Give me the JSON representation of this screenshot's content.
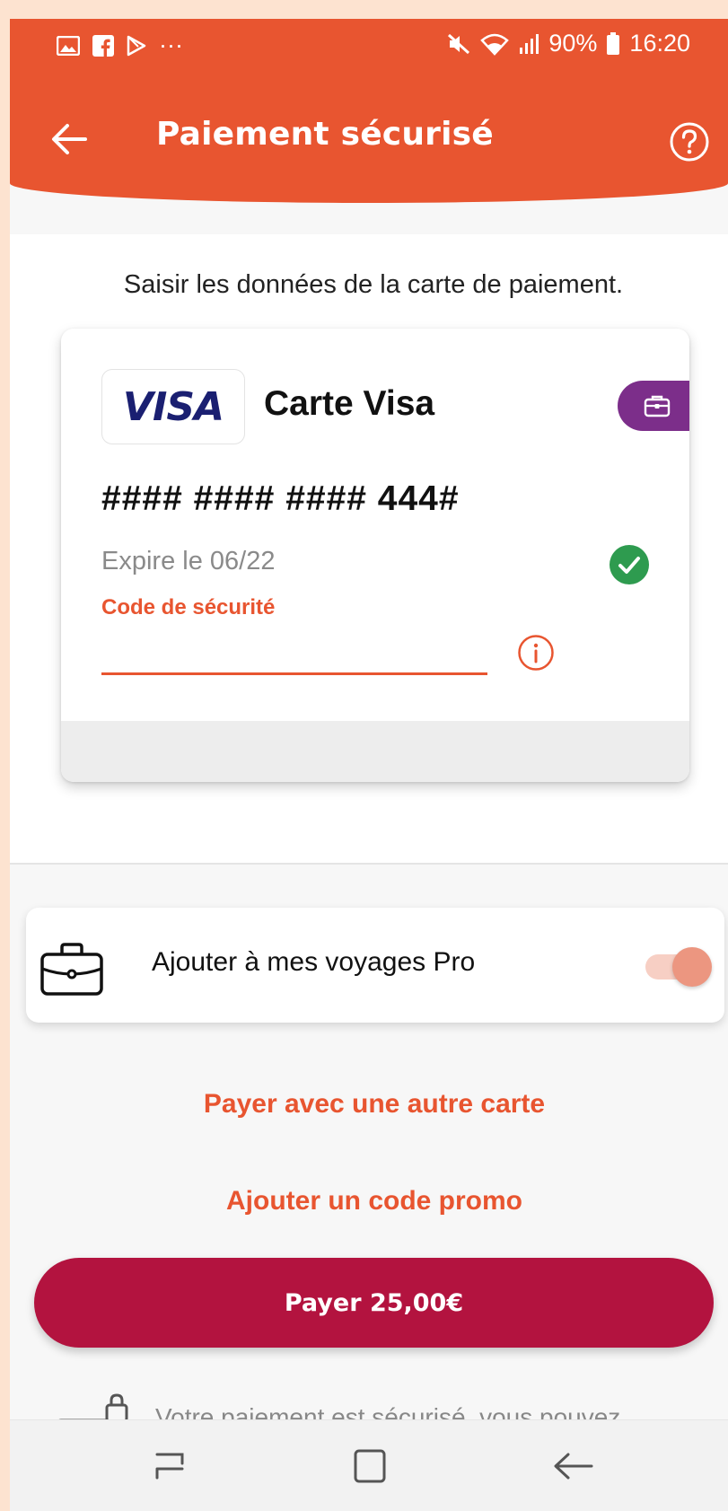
{
  "status_bar": {
    "battery": "90%",
    "time": "16:20",
    "overflow": "···"
  },
  "header": {
    "title": "Paiement sécurisé"
  },
  "instruction": "Saisir les données de la carte de paiement.",
  "card": {
    "brand_logo": "VISA",
    "name": "Carte Visa",
    "number": "#### #### #### 444#",
    "expiry": "Expire le 06/22",
    "security_label": "Code de sécurité",
    "security_value": ""
  },
  "pro": {
    "label": "Ajouter à mes voyages Pro",
    "enabled": true
  },
  "links": {
    "other_card": "Payer avec une autre carte",
    "promo": "Ajouter un code promo"
  },
  "pay_button": "Payer 25,00€",
  "secure_notice": "Votre paiement est sécurisé, vous pouvez",
  "colors": {
    "brand_orange": "#e85530",
    "pay_crimson": "#b3133f",
    "pro_purple": "#7c2e8a",
    "success_green": "#2e9b4f",
    "visa_blue": "#1a1f71"
  },
  "icons": [
    "gallery-icon",
    "facebook-icon",
    "play-store-icon",
    "mute-icon",
    "wifi-icon",
    "signal-icon",
    "battery-icon",
    "back-arrow-icon",
    "help-icon",
    "briefcase-icon",
    "check-circle-icon",
    "info-icon",
    "lock-card-icon",
    "recent-apps-icon",
    "home-icon",
    "nav-back-icon"
  ]
}
